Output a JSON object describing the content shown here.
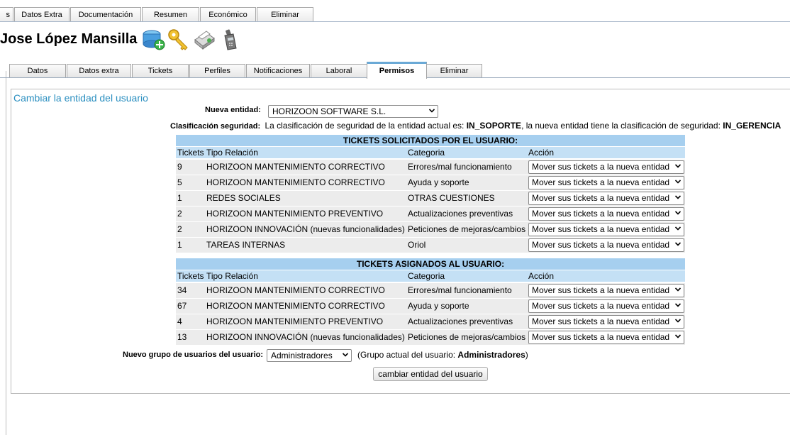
{
  "top_tabs": [
    "s",
    "Datos Extra",
    "Documentación",
    "Resumen",
    "Económico",
    "Eliminar"
  ],
  "user": {
    "name": "Jose López Mansilla"
  },
  "header_icons": [
    "database-add-icon",
    "key-icon",
    "printer-icon",
    "phone-icon"
  ],
  "sub_tabs": [
    "Datos",
    "Datos extra",
    "Tickets",
    "Perfiles",
    "Notificaciones",
    "Laboral",
    "Permisos",
    "Eliminar"
  ],
  "active_sub_tab": "Permisos",
  "panel": {
    "title": "Cambiar la entidad del usuario",
    "nueva_entidad_label": "Nueva entidad:",
    "nueva_entidad_value": "HORIZOON SOFTWARE S.L.",
    "clasificacion_label": "Clasificación seguridad:",
    "clasificacion_text_1": "La clasificación de seguridad de la entidad actual es:",
    "clasificacion_actual": "IN_SOPORTE",
    "clasificacion_text_2": ", la nueva entidad tiene la clasificación de seguridad:",
    "clasificacion_nueva": "IN_GERENCIA"
  },
  "columns": {
    "tickets": "Tickets",
    "tipo": "Tipo Relación",
    "categoria": "Categoria",
    "accion": "Acción"
  },
  "solicitados": {
    "title": "TICKETS SOLICITADOS POR EL USUARIO:",
    "rows": [
      {
        "tickets": "9",
        "tipo": "HORIZOON MANTENIMIENTO CORRECTIVO",
        "categoria": "Errores/mal funcionamiento",
        "accion": "Mover sus tickets a la nueva entidad"
      },
      {
        "tickets": "5",
        "tipo": "HORIZOON MANTENIMIENTO CORRECTIVO",
        "categoria": "Ayuda y soporte",
        "accion": "Mover sus tickets a la nueva entidad"
      },
      {
        "tickets": "1",
        "tipo": "REDES SOCIALES",
        "categoria": "OTRAS CUESTIONES",
        "accion": "Mover sus tickets a la nueva entidad"
      },
      {
        "tickets": "2",
        "tipo": "HORIZOON MANTENIMIENTO PREVENTIVO",
        "categoria": "Actualizaciones preventivas",
        "accion": "Mover sus tickets a la nueva entidad"
      },
      {
        "tickets": "2",
        "tipo": "HORIZOON INNOVACIÓN (nuevas funcionalidades)",
        "categoria": "Peticiones de mejoras/cambios",
        "accion": "Mover sus tickets a la nueva entidad"
      },
      {
        "tickets": "1",
        "tipo": "TAREAS INTERNAS",
        "categoria": "Oriol",
        "accion": "Mover sus tickets a la nueva entidad"
      }
    ]
  },
  "asignados": {
    "title": "TICKETS ASIGNADOS AL USUARIO:",
    "rows": [
      {
        "tickets": "34",
        "tipo": "HORIZOON MANTENIMIENTO CORRECTIVO",
        "categoria": "Errores/mal funcionamiento",
        "accion": "Mover sus tickets a la nueva entidad"
      },
      {
        "tickets": "67",
        "tipo": "HORIZOON MANTENIMIENTO CORRECTIVO",
        "categoria": "Ayuda y soporte",
        "accion": "Mover sus tickets a la nueva entidad"
      },
      {
        "tickets": "4",
        "tipo": "HORIZOON MANTENIMIENTO PREVENTIVO",
        "categoria": "Actualizaciones preventivas",
        "accion": "Mover sus tickets a la nueva entidad"
      },
      {
        "tickets": "13",
        "tipo": "HORIZOON INNOVACIÓN (nuevas funcionalidades)",
        "categoria": "Peticiones de mejoras/cambios",
        "accion": "Mover sus tickets a la nueva entidad"
      }
    ]
  },
  "grupo": {
    "label": "Nuevo grupo de usuarios del usuario:",
    "value": "Administradores",
    "actual_prefix": "(Grupo actual del usuario:",
    "actual_value": "Administradores",
    "actual_suffix": ")"
  },
  "submit_label": "cambiar entidad del usuario"
}
